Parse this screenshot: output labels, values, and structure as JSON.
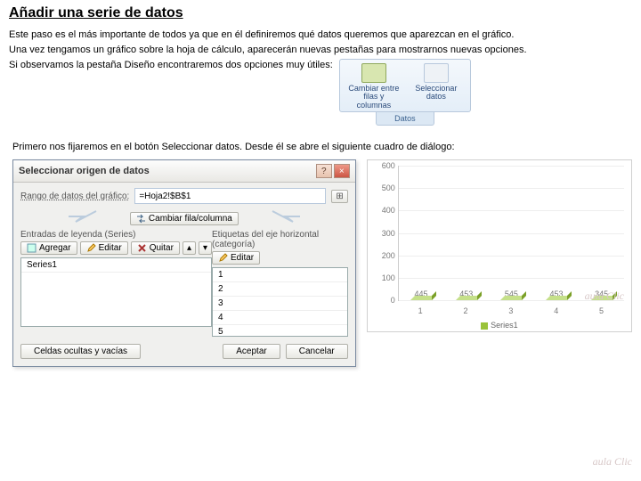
{
  "title": "Añadir una serie de datos",
  "paragraphs": {
    "p1": "Este paso es el más importante de todos ya que en él definiremos qué datos queremos que aparezcan en el gráfico.",
    "p2": "Una vez tengamos un gráfico sobre la hoja de cálculo, aparecerán nuevas pestañas para mostrarnos nuevas opciones.",
    "p3": "Si observamos la pestaña Diseño encontraremos dos opciones muy útiles:",
    "p4": "Primero nos fijaremos en el botón Seleccionar datos. Desde él se abre el siguiente cuadro de diálogo:"
  },
  "ribbon": {
    "btn1": "Cambiar entre filas y columnas",
    "btn2": "Seleccionar datos",
    "group": "Datos"
  },
  "dialog": {
    "title": "Seleccionar origen de datos",
    "range_label": "Rango de datos del gráfico:",
    "range_value": "=Hoja2!$B$1",
    "switch": "Cambiar fila/columna",
    "left_head": "Entradas de leyenda (Series)",
    "right_head": "Etiquetas del eje horizontal (categoría)",
    "add": "Agregar",
    "edit": "Editar",
    "remove": "Quitar",
    "edit2": "Editar",
    "series_item": "Series1",
    "cats": [
      "1",
      "2",
      "3",
      "4",
      "5"
    ],
    "hidden": "Celdas ocultas y vacías",
    "ok": "Aceptar",
    "cancel": "Cancelar"
  },
  "chart_data": {
    "type": "bar",
    "categories": [
      "1",
      "2",
      "3",
      "4",
      "5"
    ],
    "values": [
      445,
      453,
      545,
      453,
      345
    ],
    "series_name": "Series1",
    "ylim": [
      0,
      600
    ],
    "yticks": [
      0,
      100,
      200,
      300,
      400,
      500,
      600
    ]
  },
  "watermark": "aula Clic"
}
